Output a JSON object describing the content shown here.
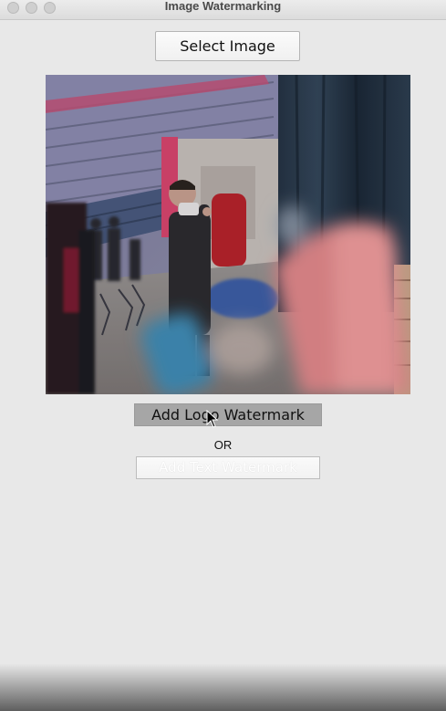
{
  "window": {
    "title": "Image Watermarking"
  },
  "buttons": {
    "select_image": "Select Image",
    "add_logo_watermark": "Add Logo Watermark",
    "add_text_watermark": "Add Text Watermark"
  },
  "separator": {
    "or_label": "OR"
  },
  "icons": {
    "window_close": "close-dot-icon",
    "window_minimize": "minimize-dot-icon",
    "window_zoom": "zoom-dot-icon",
    "cursor": "mouse-pointer-icon"
  },
  "colors": {
    "window_background": "#e8e8e8",
    "logo_button_background": "#a6a6a6",
    "text_button_label": "#ffffff"
  }
}
